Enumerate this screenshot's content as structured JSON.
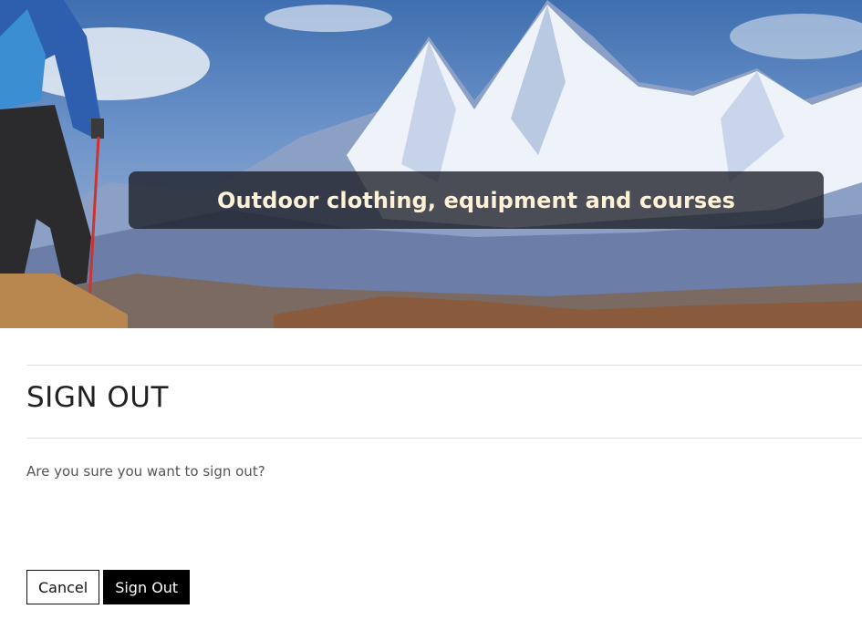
{
  "hero": {
    "banner_text": "Outdoor clothing, equipment and courses",
    "image_description_icon": "mountain-hiker-image"
  },
  "main": {
    "title": "SIGN OUT",
    "message": "Are you sure you want to sign out?",
    "buttons": {
      "cancel_label": "Cancel",
      "signout_label": "Sign Out"
    }
  },
  "colors": {
    "banner_text": "#fdf1d6",
    "banner_bg": "#1c1e26",
    "primary_button": "#000000",
    "divider": "#dedede"
  }
}
